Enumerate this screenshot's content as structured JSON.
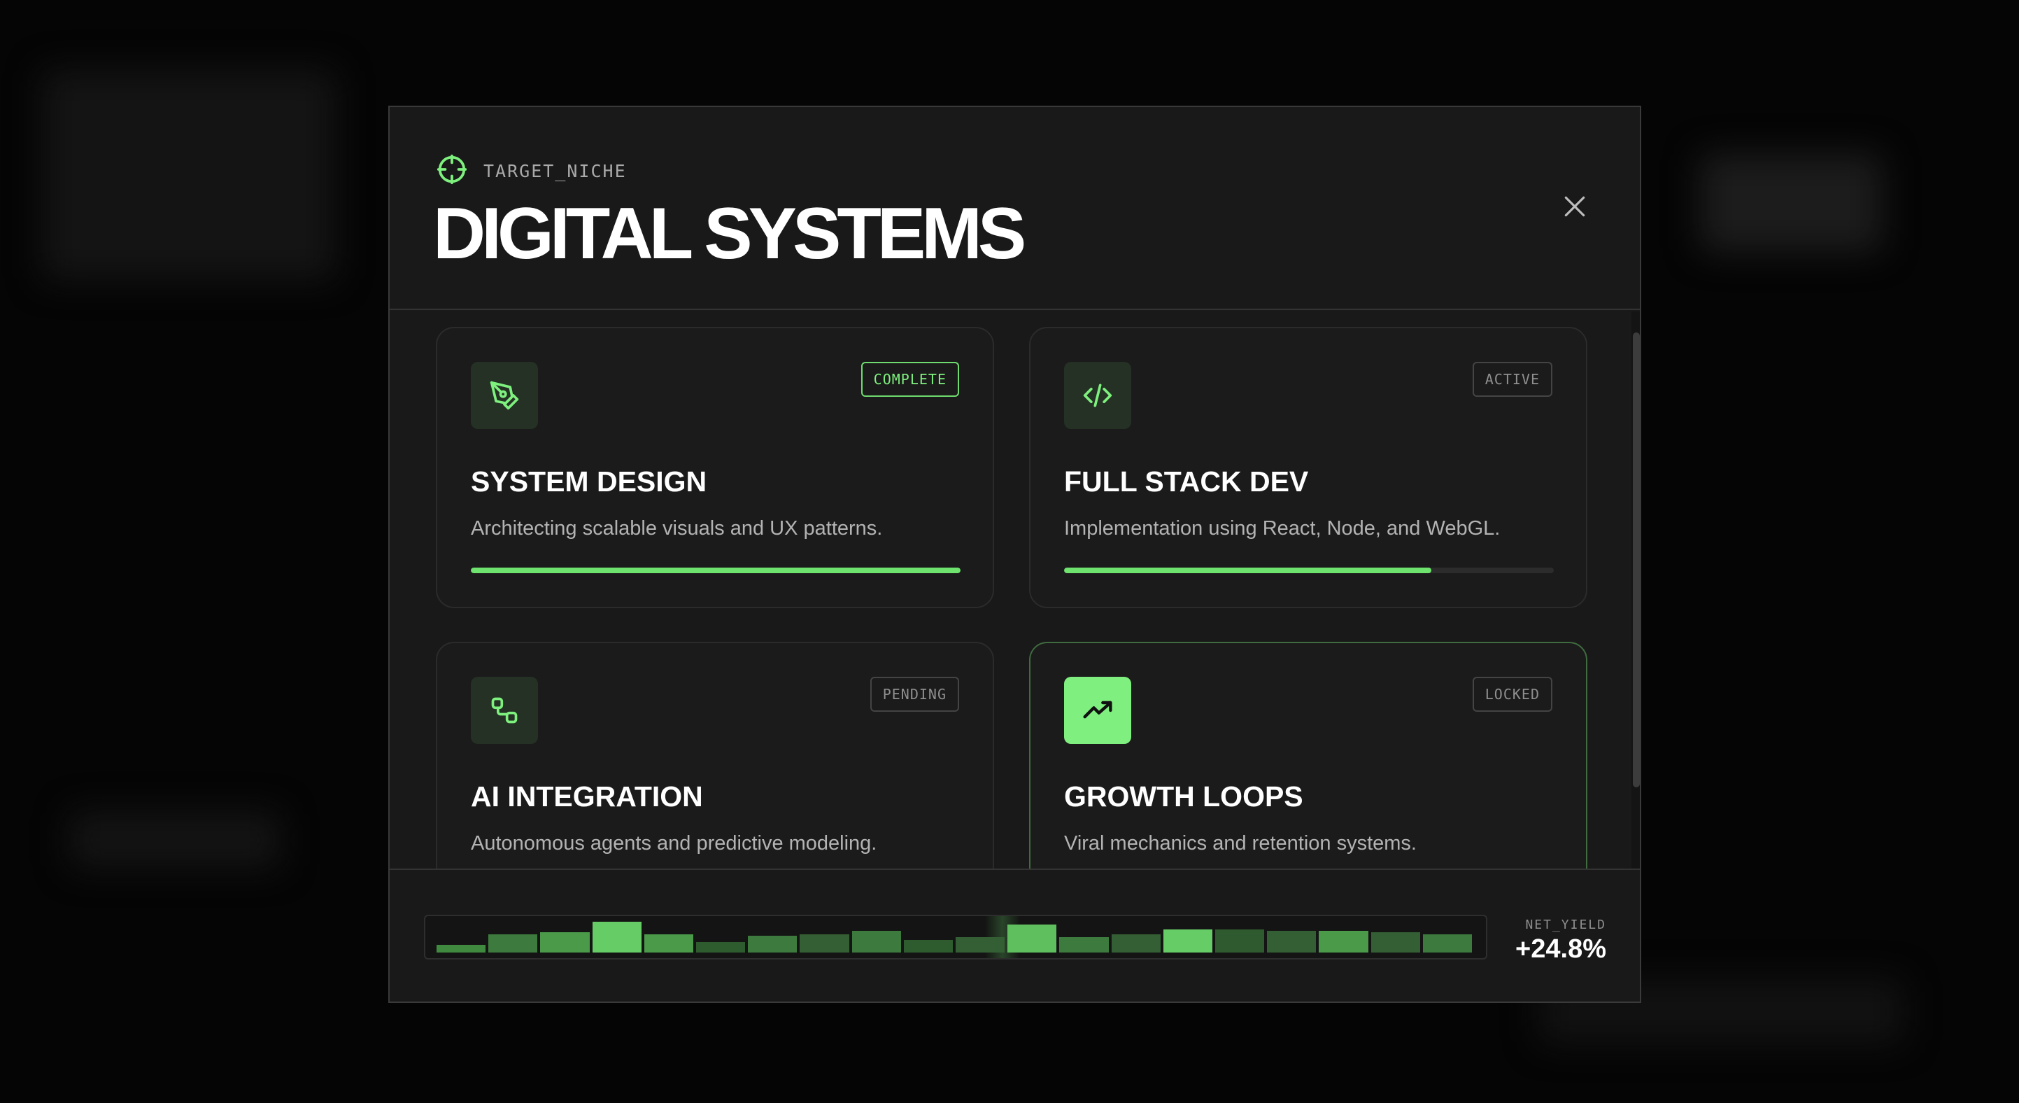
{
  "header": {
    "eyebrow_icon": "crosshair-icon",
    "eyebrow": "TARGET_NICHE",
    "title": "DIGITAL SYSTEMS",
    "close_icon": "close-icon"
  },
  "colors": {
    "accent": "#7ef07e",
    "modal_bg": "#191919",
    "card_bg": "#1b1b1b",
    "icon_bg": "#243124"
  },
  "cards": [
    {
      "icon": "pen-tool-icon",
      "badge": "COMPLETE",
      "title": "SYSTEM DESIGN",
      "description": "Architecting scalable visuals and UX patterns.",
      "progress": 1.0
    },
    {
      "icon": "code-icon",
      "badge": "ACTIVE",
      "title": "FULL STACK DEV",
      "description": "Implementation using React, Node, and WebGL.",
      "progress": 0.75
    },
    {
      "icon": "workflow-icon",
      "badge": "PENDING",
      "title": "AI INTEGRATION",
      "description": "Autonomous agents and predictive modeling.",
      "progress": 0
    },
    {
      "icon": "trending-up-icon",
      "badge": "LOCKED",
      "title": "GROWTH LOOPS",
      "description": "Viral mechanics and retention systems.",
      "progress": 0
    }
  ],
  "footer": {
    "sparkline": {
      "values": [
        0.25,
        0.6,
        0.65,
        1.0,
        0.6,
        0.35,
        0.55,
        0.6,
        0.7,
        0.4,
        0.5,
        0.9,
        0.5,
        0.6,
        0.75,
        0.75,
        0.7,
        0.7,
        0.65,
        0.6
      ],
      "shades": [
        "#3f8a3f",
        "#3d7a3d",
        "#4a9a4a",
        "#66cc66",
        "#4a9a4a",
        "#2e5c2e",
        "#3d7a3d",
        "#345f34",
        "#3d7a3d",
        "#2e5c2e",
        "#345f34",
        "#5fbf5f",
        "#3d7a3d",
        "#345f34",
        "#66cc66",
        "#2f5a2f",
        "#345f34",
        "#4a9a4a",
        "#345f34",
        "#3d7a3d"
      ]
    },
    "yield_label": "NET_YIELD",
    "yield_value": "+24.8%"
  }
}
